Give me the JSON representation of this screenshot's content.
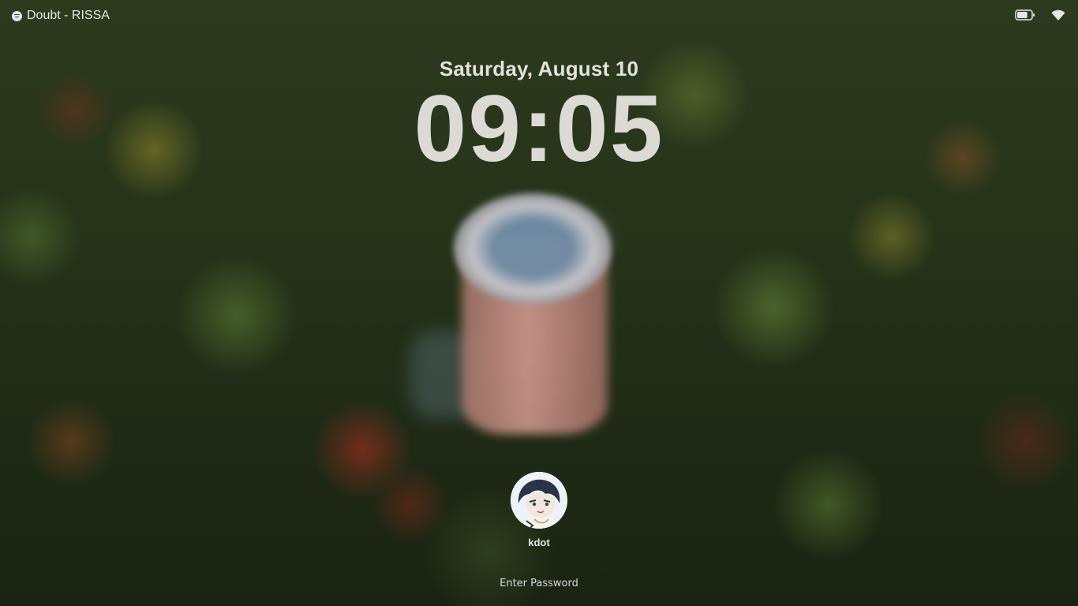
{
  "top_bar": {
    "media": {
      "icon": "spotify-icon",
      "track_title": "Doubt - RISSA"
    },
    "status": {
      "battery_icon": "battery-icon",
      "battery_level": 0.75,
      "wifi_icon": "wifi-icon"
    }
  },
  "clock": {
    "date": "Saturday, August 10",
    "time": "09:05"
  },
  "user": {
    "avatar": "anime-character-avatar",
    "name": "kdot"
  },
  "password_field": {
    "placeholder": "Enter Password",
    "value": ""
  },
  "colors": {
    "text_primary": "#e4e2dc",
    "clock_text": "#dcdad4"
  }
}
